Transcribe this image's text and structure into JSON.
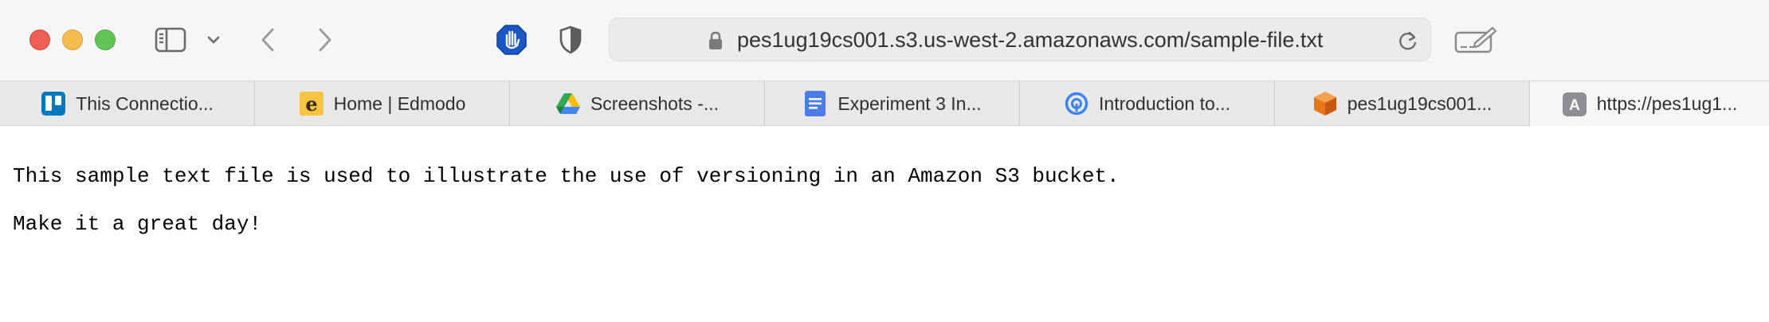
{
  "toolbar": {
    "url": "pes1ug19cs001.s3.us-west-2.amazonaws.com/sample-file.txt",
    "icons": [
      "close-icon",
      "minimize-icon",
      "zoom-icon",
      "sidebar-icon",
      "chevron-down-icon",
      "back-arrow-icon",
      "forward-arrow-icon",
      "hand-stop-icon",
      "shield-icon",
      "lock-icon",
      "reload-icon",
      "edit-share-icon"
    ]
  },
  "tabs": [
    {
      "title": "This Connectio...",
      "favicon": "trello-icon",
      "color": "#0079bf"
    },
    {
      "title": "Home | Edmodo",
      "favicon": "edmodo-icon",
      "color": "#f6c343"
    },
    {
      "title": "Screenshots -...",
      "favicon": "google-drive-icon",
      "color": "#34a853"
    },
    {
      "title": "Experiment 3 In...",
      "favicon": "google-docs-icon",
      "color": "#4a7de8"
    },
    {
      "title": "Introduction to...",
      "favicon": "info-circle-icon",
      "color": "#3b82f6"
    },
    {
      "title": "pes1ug19cs001...",
      "favicon": "aws-cube-icon",
      "color": "#f28c28"
    },
    {
      "title": "https://pes1ug1...",
      "favicon": "letter-a-icon",
      "favicon_letter": "A",
      "color": "#8e8e93"
    }
  ],
  "content": {
    "lines": [
      "This sample text file is used to illustrate the use of versioning in an Amazon S3 bucket.",
      "Make it a great day!"
    ]
  }
}
